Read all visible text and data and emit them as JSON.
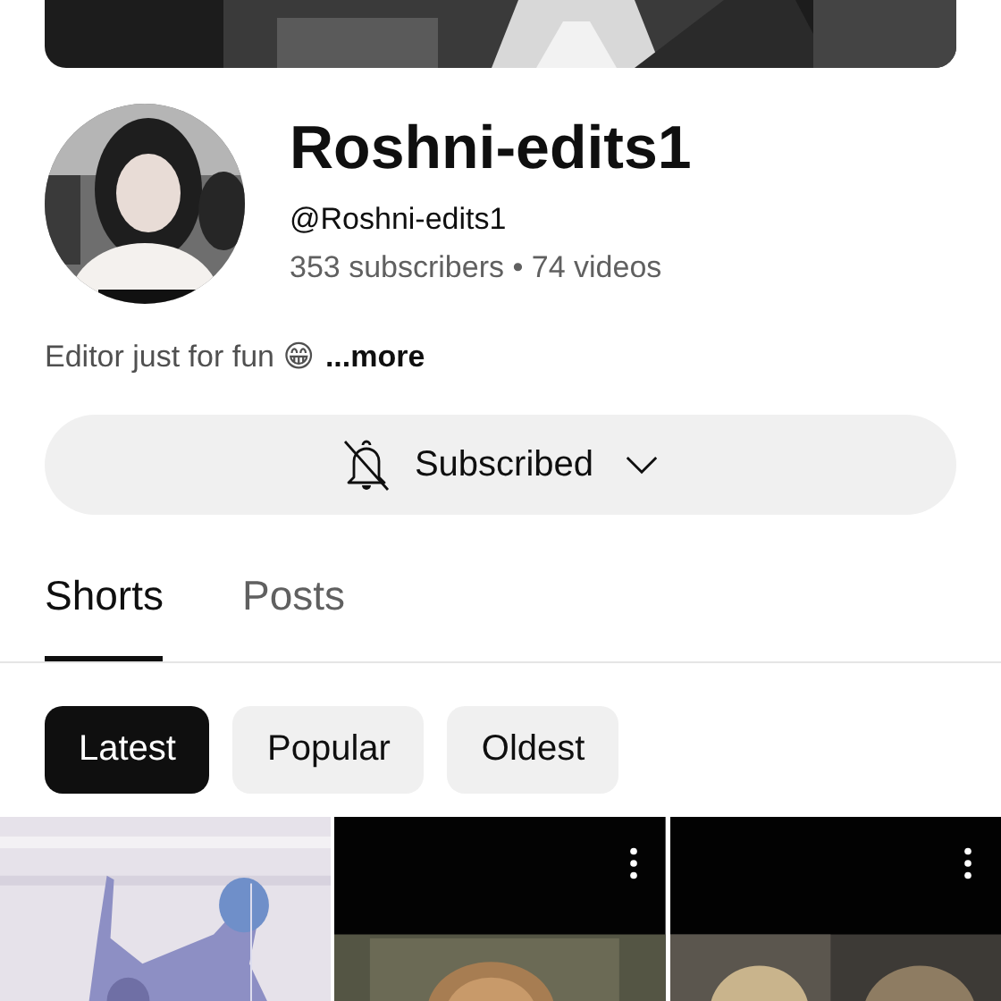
{
  "banner": {
    "kind": "picture"
  },
  "channel": {
    "avatar": {
      "kind": "picture"
    },
    "name": "Roshni-edits1",
    "handle": "@Roshni-edits1",
    "stats": "353 subscribers • 74 videos"
  },
  "description": {
    "text": "Editor just for fun 😁",
    "more": "...more"
  },
  "subscribe_button": {
    "label": "Subscribed",
    "notifications": false
  },
  "tabs": [
    {
      "label": "Shorts",
      "selected": true
    },
    {
      "label": "Posts",
      "selected": false
    }
  ],
  "chips": [
    {
      "label": "Latest",
      "selected": true
    },
    {
      "label": "Popular",
      "selected": false
    },
    {
      "label": "Oldest",
      "selected": false
    }
  ],
  "shorts": [
    {
      "kind": "picture",
      "menu": false
    },
    {
      "kind": "picture",
      "menu": true
    },
    {
      "kind": "picture",
      "menu": true
    }
  ]
}
